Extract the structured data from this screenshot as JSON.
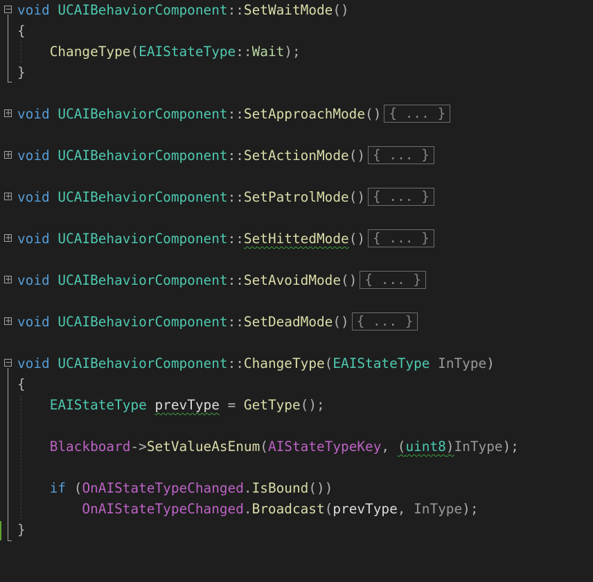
{
  "editor": {
    "class_name": "UCAIBehaviorComponent",
    "scope_op": "::",
    "keyword_void": "void",
    "set_wait": {
      "name": "SetWaitMode",
      "parens": "()",
      "open_brace": "{",
      "close_brace": "}",
      "call": "ChangeType",
      "enum_type": "EAIStateType",
      "enum_value": "Wait",
      "call_end": ");"
    },
    "collapsed_functions": [
      {
        "name": "SetApproachMode"
      },
      {
        "name": "SetActionMode"
      },
      {
        "name": "SetPatrolMode"
      },
      {
        "name": "SetHittedMode"
      },
      {
        "name": "SetAvoidMode"
      },
      {
        "name": "SetDeadMode"
      }
    ],
    "collapsed_placeholder": "{ ... }",
    "change_type": {
      "name": "ChangeType",
      "param_type": "EAIStateType",
      "param_name": "InType",
      "local_type": "EAIStateType",
      "local_name": "prevType",
      "assign": " = ",
      "get_call": "GetType",
      "blackboard": "Blackboard",
      "arrow": "->",
      "set_call": "SetValueAsEnum",
      "key_name": "AIStateTypeKey",
      "cast_type": "uint8",
      "if_kw": "if",
      "delegate": "OnAIStateTypeChanged",
      "is_bound": "IsBound",
      "broadcast": "Broadcast"
    }
  }
}
